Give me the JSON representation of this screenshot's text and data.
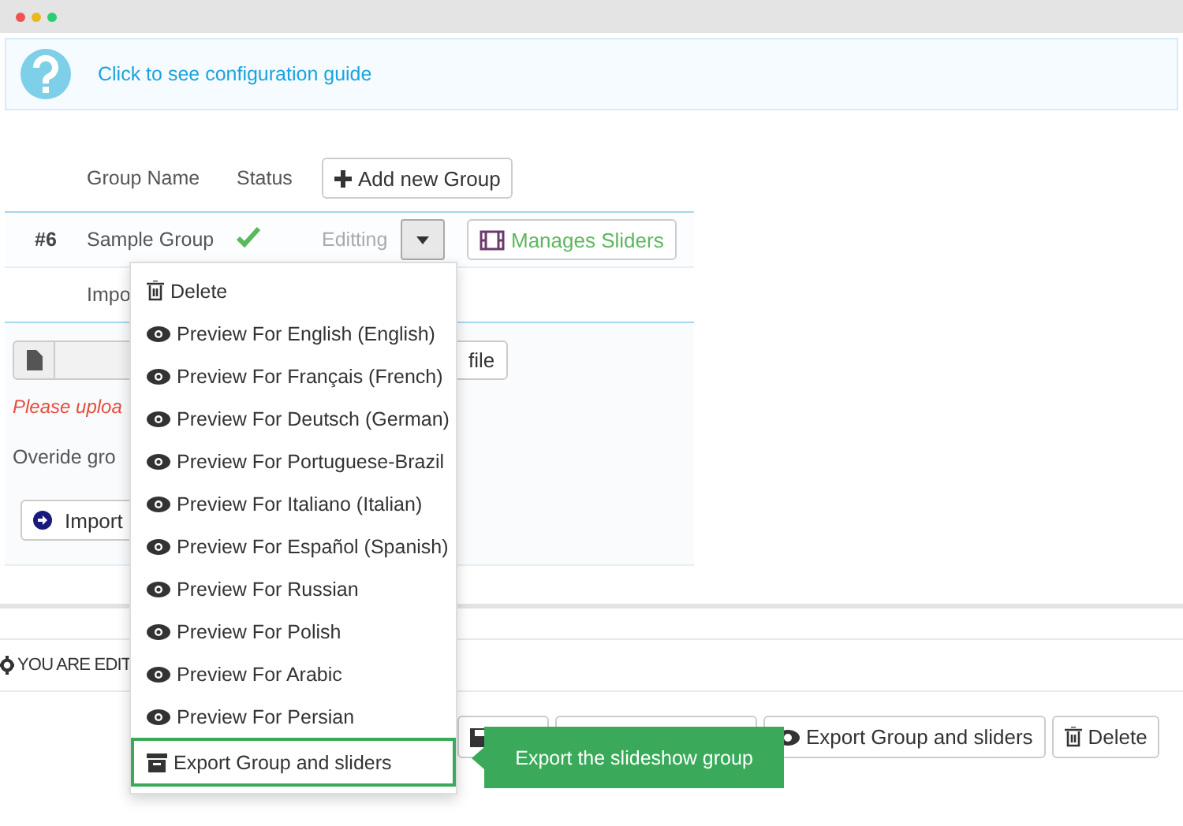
{
  "guide": {
    "text": "Click to see configuration guide"
  },
  "table": {
    "columns": [
      "Group Name",
      "Status"
    ],
    "add_button": "Add new Group",
    "rows": [
      {
        "id": "#6",
        "name": "Sample Group",
        "active": true,
        "action": "Editting",
        "manage_button": "Manages Sliders"
      }
    ]
  },
  "import_row": {
    "label": "Impo"
  },
  "import_panel": {
    "file_button": "file",
    "error": "Please uploa",
    "override_label": "Overide gro",
    "import_button": "Import"
  },
  "editing_heading": "YOU ARE EDIT",
  "toolbar": {
    "buttons": [
      {
        "kind": "save"
      },
      {
        "kind": "manage"
      },
      {
        "kind": "export",
        "label": "Export Group and sliders"
      },
      {
        "kind": "delete",
        "label": "Delete"
      }
    ]
  },
  "dropdown": {
    "items": [
      {
        "kind": "delete",
        "label": "Delete",
        "selected": false
      },
      {
        "kind": "preview",
        "label": "Preview For English (English)",
        "selected": false
      },
      {
        "kind": "preview",
        "label": "Preview For Français (French)",
        "selected": false
      },
      {
        "kind": "preview",
        "label": "Preview For Deutsch (German)",
        "selected": false
      },
      {
        "kind": "preview",
        "label": "Preview For Portuguese-Brazil",
        "selected": false
      },
      {
        "kind": "preview",
        "label": "Preview For Italiano (Italian)",
        "selected": false
      },
      {
        "kind": "preview",
        "label": "Preview For Español (Spanish)",
        "selected": false
      },
      {
        "kind": "preview",
        "label": "Preview For Russian",
        "selected": false
      },
      {
        "kind": "preview",
        "label": "Preview For Polish",
        "selected": false
      },
      {
        "kind": "preview",
        "label": "Preview For Arabic",
        "selected": false
      },
      {
        "kind": "preview",
        "label": "Preview For Persian",
        "selected": false
      },
      {
        "kind": "export",
        "label": "Export Group and sliders",
        "selected": true
      }
    ]
  },
  "tooltip": {
    "text": "Export the slideshow group"
  }
}
